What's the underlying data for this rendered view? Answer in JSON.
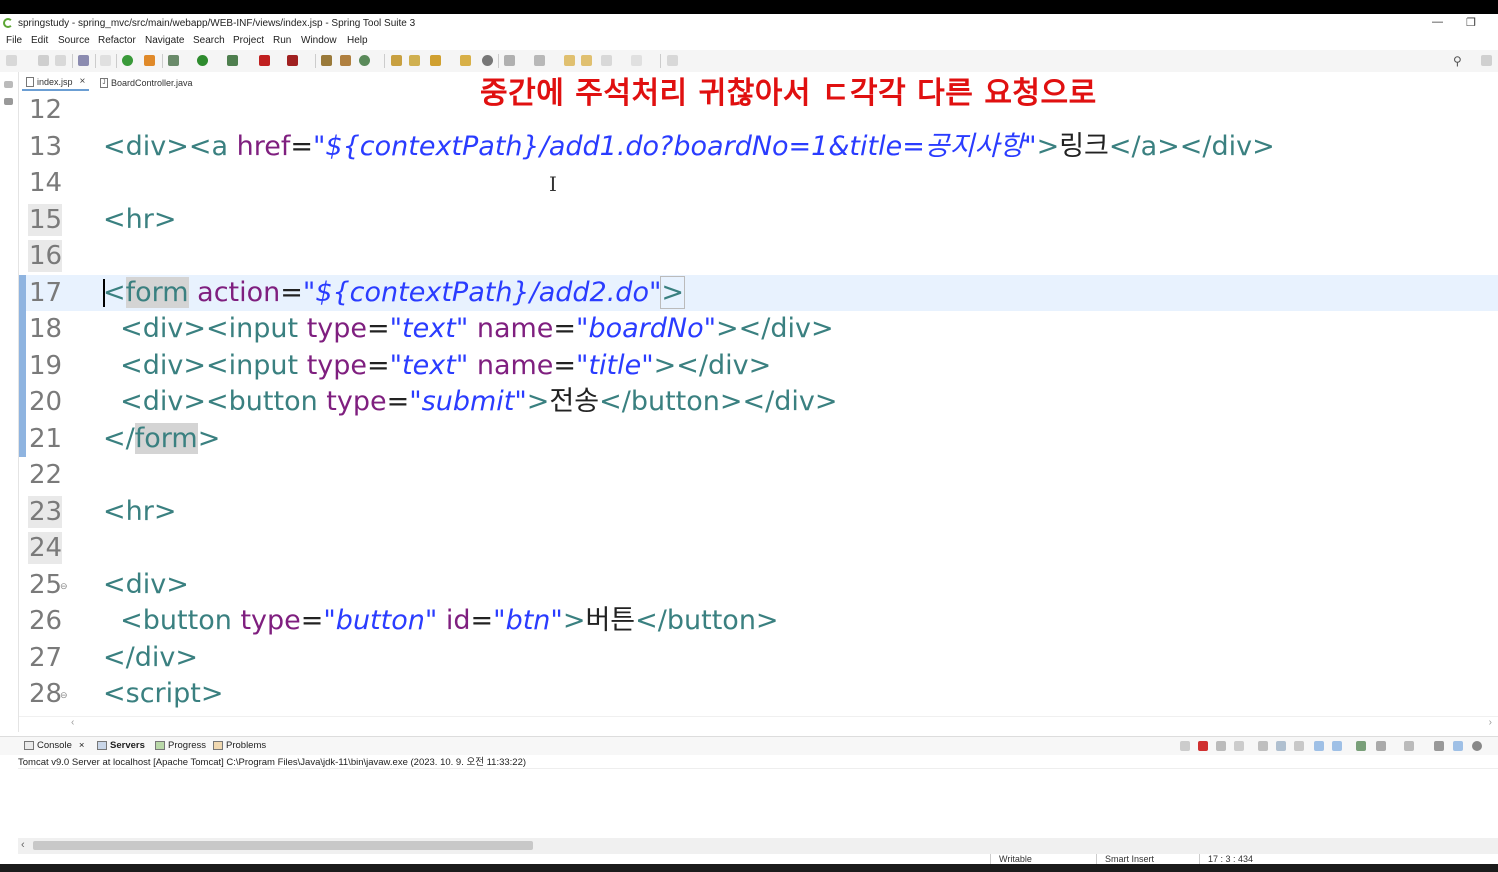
{
  "window": {
    "title": "springstudy - spring_mvc/src/main/webapp/WEB-INF/views/index.jsp - Spring Tool Suite 3",
    "minimize_label": "—",
    "restore_label": "❐"
  },
  "menu": [
    "File",
    "Edit",
    "Source",
    "Refactor",
    "Navigate",
    "Search",
    "Project",
    "Run",
    "Window",
    "Help"
  ],
  "tabs": [
    {
      "label": "index.jsp",
      "active": true,
      "close": "×"
    },
    {
      "label": "BoardController.java",
      "active": false
    }
  ],
  "annotation": "중간에 주석처리 귀찮아서 ㄷ각각 다른 요청으로",
  "editor": {
    "lines": [
      {
        "no": "12"
      },
      {
        "no": "13",
        "p1": "<div><a ",
        "a1": "href",
        "e1": "=",
        "s1": "\"${contextPath}/add1.do?boardNo=1&title=공지사항\"",
        "t1": ">",
        "x1": "링크",
        "t2": "</a></div>"
      },
      {
        "no": "14"
      },
      {
        "no": "15",
        "p1": "<hr>"
      },
      {
        "no": "16"
      },
      {
        "no": "17",
        "p0": "<",
        "p1": "form",
        "a1": " action",
        "e1": "=",
        "s1": "\"${contextPath}/add2.do\"",
        "t1": ">"
      },
      {
        "no": "18",
        "p1": "  <div><input ",
        "a1": "type",
        "e1": "=",
        "s1": "\"text\"",
        "a2": " name",
        "e2": "=",
        "s2": "\"boardNo\"",
        "t1": "></div>"
      },
      {
        "no": "19",
        "p1": "  <div><input ",
        "a1": "type",
        "e1": "=",
        "s1": "\"text\"",
        "a2": " name",
        "e2": "=",
        "s2": "\"title\"",
        "t1": "></div>"
      },
      {
        "no": "20",
        "p1": "  <div><button ",
        "a1": "type",
        "e1": "=",
        "s1": "\"submit\"",
        "t1": ">",
        "x1": "전송",
        "t2": "</button></div>"
      },
      {
        "no": "21",
        "p1": "</",
        "p2": "form",
        "t1": ">"
      },
      {
        "no": "22"
      },
      {
        "no": "23",
        "p1": "<hr>"
      },
      {
        "no": "24"
      },
      {
        "no": "25",
        "p1": "<div>"
      },
      {
        "no": "26",
        "p1": "  <button ",
        "a1": "type",
        "e1": "=",
        "s1": "\"button\"",
        "a2": " id",
        "e2": "=",
        "s2": "\"btn\"",
        "t1": ">",
        "x1": "버튼",
        "t2": "</button>"
      },
      {
        "no": "27",
        "p1": "</div>"
      },
      {
        "no": "28",
        "p1": "<script>"
      }
    ]
  },
  "bottom_panel": {
    "tabs": [
      "Console",
      "Servers",
      "Progress",
      "Problems"
    ],
    "close": "×",
    "server_info": "Tomcat v9.0 Server at localhost [Apache Tomcat] C:\\Program Files\\Java\\jdk-11\\bin\\javaw.exe  (2023. 10. 9. 오전 11:33:22)"
  },
  "statusbar": {
    "writable": "Writable",
    "insert_mode": "Smart Insert",
    "position": "17 : 3 : 434"
  }
}
